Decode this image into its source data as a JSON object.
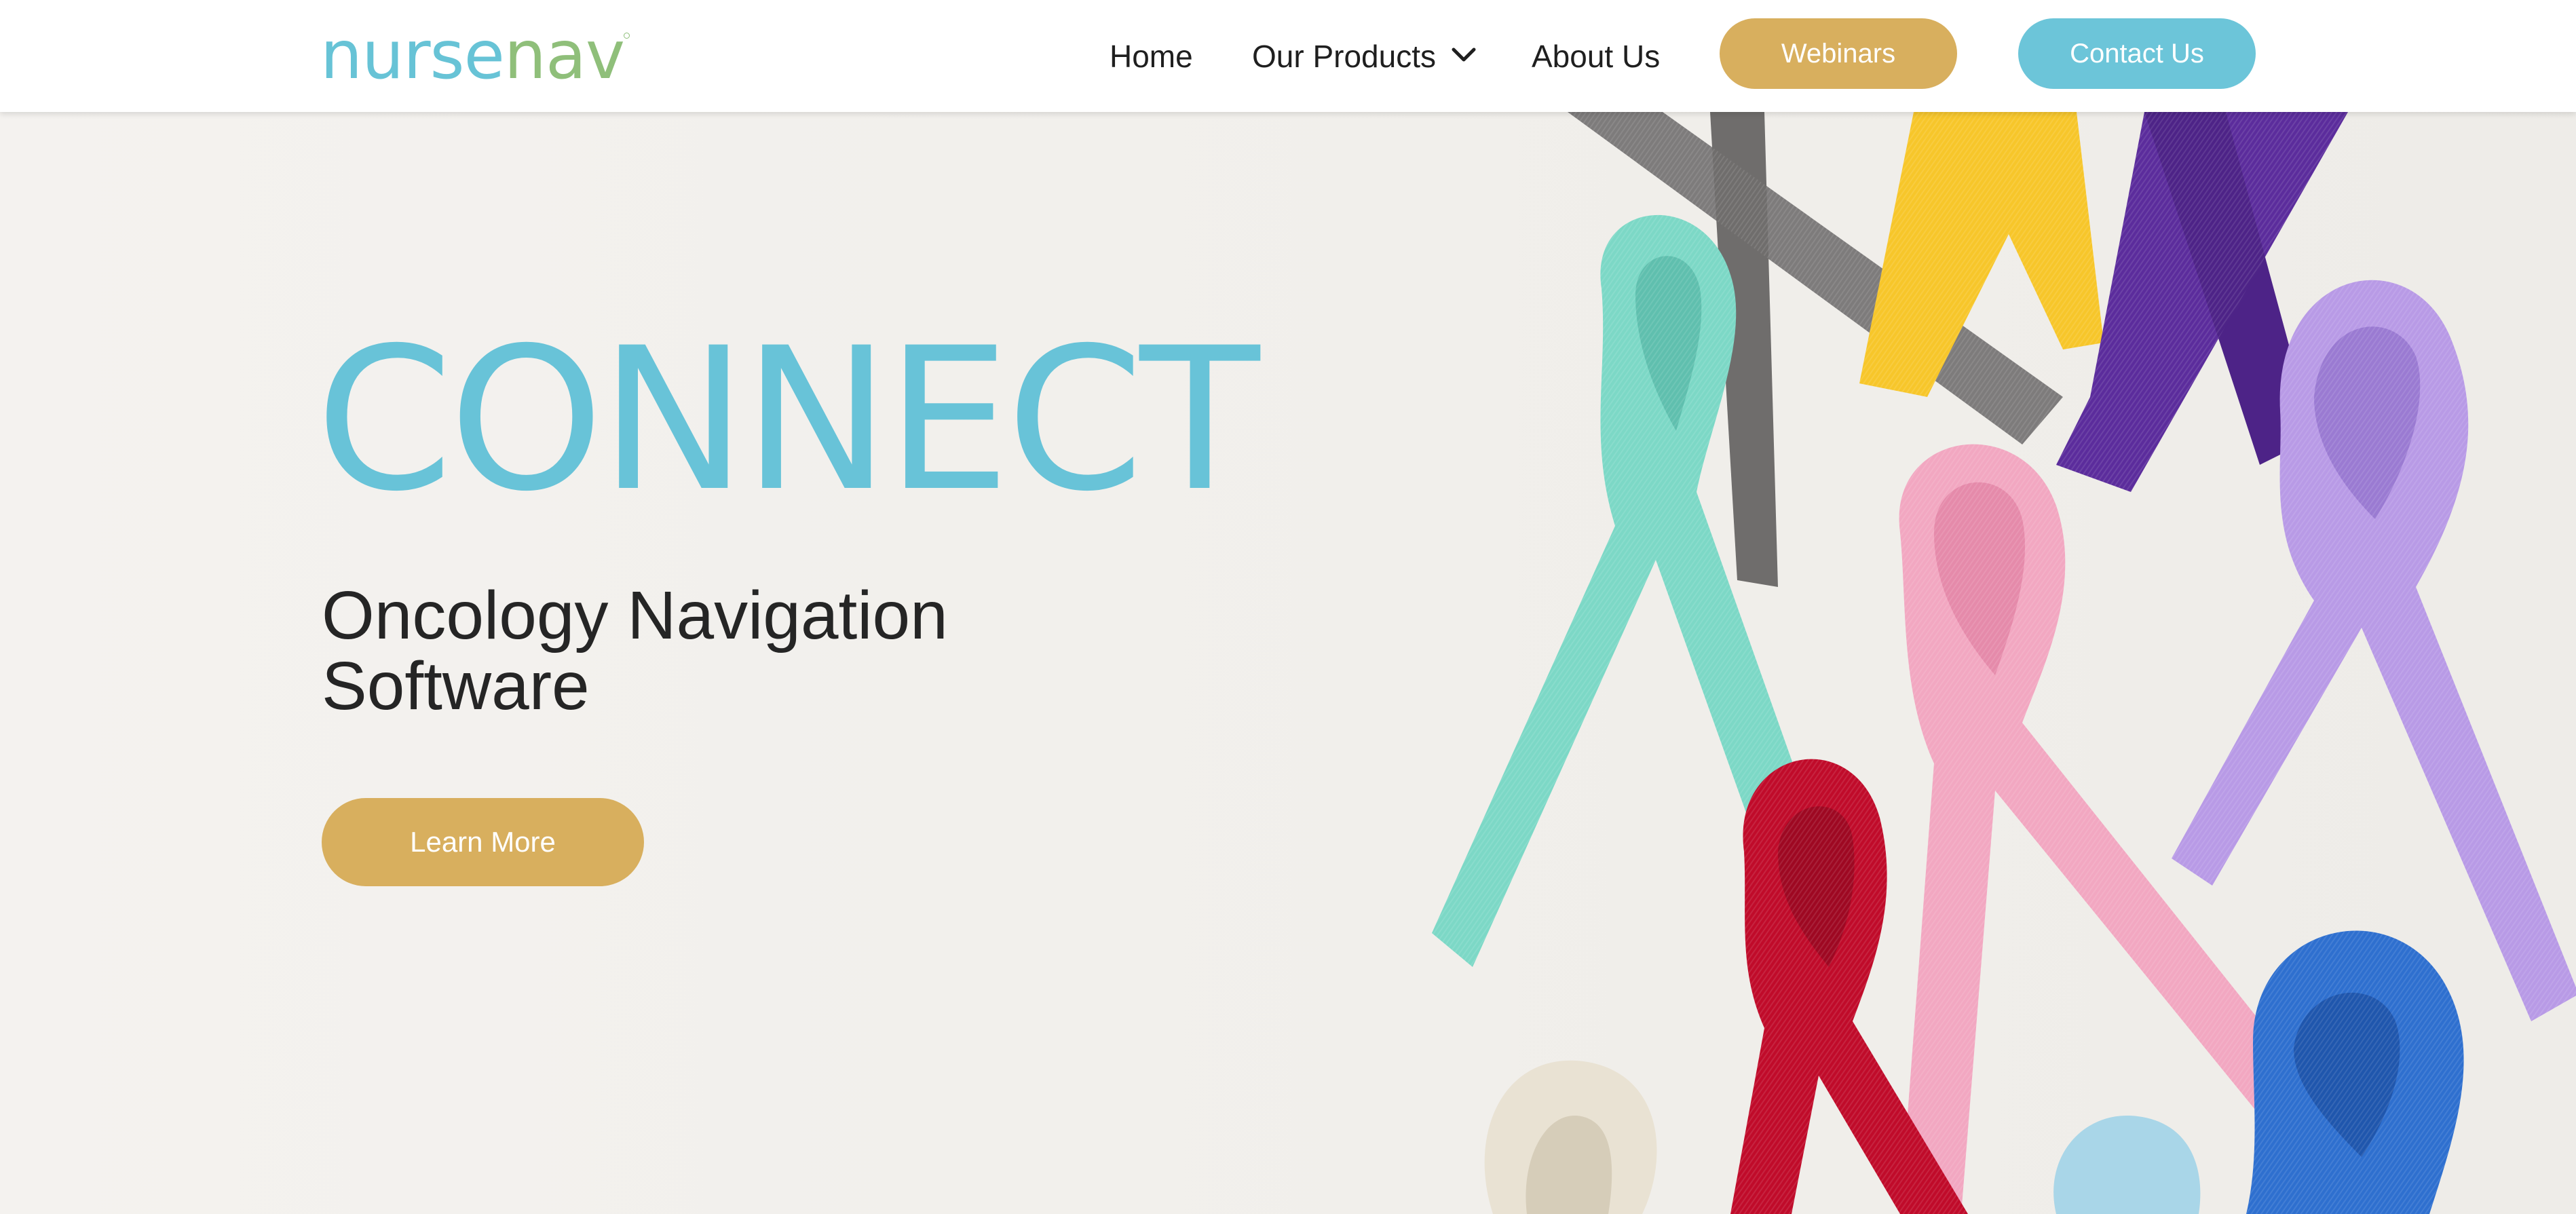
{
  "header": {
    "logo": {
      "part1": "nurse",
      "part2": "nav"
    },
    "nav": {
      "home": "Home",
      "products": "Our Products",
      "about": "About Us"
    },
    "buttons": {
      "webinars": "Webinars",
      "contact": "Contact Us"
    }
  },
  "hero": {
    "title": "CONNECT",
    "subtitle_line1": "Oncology Navigation",
    "subtitle_line2": "Software",
    "cta": "Learn More"
  },
  "colors": {
    "brand_teal": "#67c3d6",
    "brand_green": "#8fbf7a",
    "gold": "#d8af5e",
    "ribbons": [
      "#7d7b7b",
      "#f7c62a",
      "#5b2c9c",
      "#7cd8c6",
      "#f2a7c1",
      "#b89ae6",
      "#c00b2a",
      "#2e6fcf",
      "#a9d6e8",
      "#e9e2d3"
    ]
  },
  "icons": {
    "chevron": "chevron-down-icon"
  }
}
